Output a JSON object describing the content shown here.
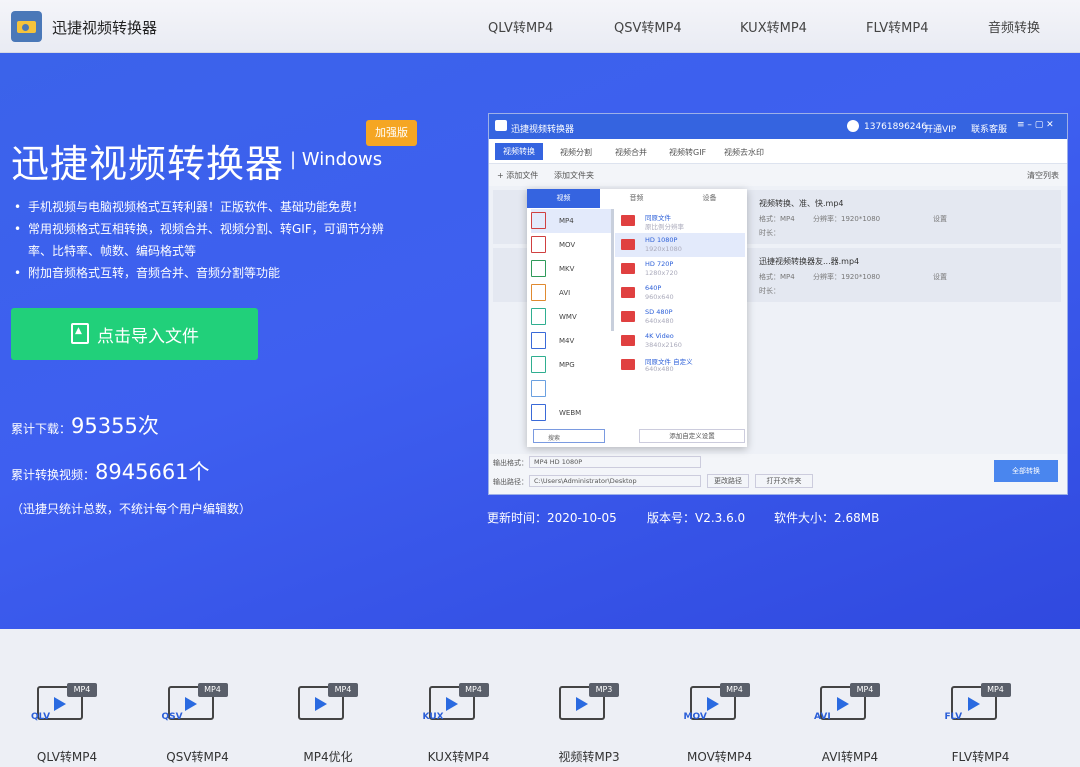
{
  "header": {
    "brand": "迅捷视频转换器",
    "nav": [
      "QLV转MP4",
      "QSV转MP4",
      "KUX转MP4",
      "FLV转MP4",
      "音频转换"
    ]
  },
  "hero": {
    "title": "迅捷视频转换器",
    "platform": "| Windows",
    "badge": "加强版",
    "features": [
      "手机视频与电脑视频格式互转利器！正版软件、基础功能免费！",
      "常用视频格式互相转换，视频合并、视频分割、转GIF，可调节分辨率、比特率、帧数、编码格式等",
      "附加音频格式互转，音频合并、音频分割等功能"
    ],
    "import_button": "点击导入文件",
    "downloads_label": "累计下载：",
    "downloads_value": "95355次",
    "converted_label": "累计转换视频：",
    "converted_value": "8945661个",
    "note": "（迅捷只统计总数，不统计每个用户编辑数）"
  },
  "app": {
    "window_title": "迅捷视频转换器",
    "phone": "13761896246",
    "vip": "开通VIP",
    "support": "联系客服",
    "tabs": [
      "视频转换",
      "视频分割",
      "视频合并",
      "视频转GIF",
      "视频去水印"
    ],
    "add_file": "+ 添加文件",
    "add_folder": "添加文件夹",
    "clear_list": "清空列表",
    "files": [
      {
        "name": "视频转换、准、快.mp4",
        "format": "格式：MP4",
        "res": "分辨率：1920*1080",
        "dur": "时长：",
        "settings": "设置"
      },
      {
        "name": "迅捷视频转换器友...器.mp4",
        "format": "格式：MP4",
        "res": "分辨率：1920*1080",
        "dur": "时长：",
        "settings": "设置"
      }
    ],
    "dropdown_tabs": [
      "视频",
      "音频",
      "设备"
    ],
    "formats": [
      "MP4",
      "MOV",
      "MKV",
      "AVI",
      "WMV",
      "M4V",
      "MPG",
      "",
      "WEBM"
    ],
    "qualities": [
      {
        "name": "同原文件",
        "detail": "原比例分辨率"
      },
      {
        "name": "HD 1080P",
        "detail": "1920x1080"
      },
      {
        "name": "HD 720P",
        "detail": "1280x720"
      },
      {
        "name": "640P",
        "detail": "960x640"
      },
      {
        "name": "SD 480P",
        "detail": "640x480"
      },
      {
        "name": "4K Video",
        "detail": "3840x2160"
      },
      {
        "name": "同原文件 自定义",
        "detail": "640x480"
      }
    ],
    "search_placeholder": "搜索",
    "custom_setting": "添加自定义设置",
    "output_format_label": "输出格式：",
    "output_format_value": "MP4  HD 1080P",
    "output_path_label": "输出路径：",
    "output_path_value": "C:\\Users\\Administrator\\Desktop",
    "change_path": "更改路径",
    "open_folder": "打开文件夹",
    "convert_all": "全部转换"
  },
  "info": {
    "updated": "更新时间：2020-10-05",
    "version": "版本号：V2.3.6.0",
    "size": "软件大小：2.68MB"
  },
  "tools": [
    {
      "label": "QLV转MP4",
      "tag": "MP4",
      "left": "QLV"
    },
    {
      "label": "QSV转MP4",
      "tag": "MP4",
      "left": "QSV"
    },
    {
      "label": "MP4优化",
      "tag": "MP4",
      "left": ""
    },
    {
      "label": "KUX转MP4",
      "tag": "MP4",
      "left": "KUX"
    },
    {
      "label": "视频转MP3",
      "tag": "MP3",
      "left": ""
    },
    {
      "label": "MOV转MP4",
      "tag": "MP4",
      "left": "MOV"
    },
    {
      "label": "AVI转MP4",
      "tag": "MP4",
      "left": "AVI"
    },
    {
      "label": "FLV转MP4",
      "tag": "MP4",
      "left": "FLV"
    }
  ]
}
